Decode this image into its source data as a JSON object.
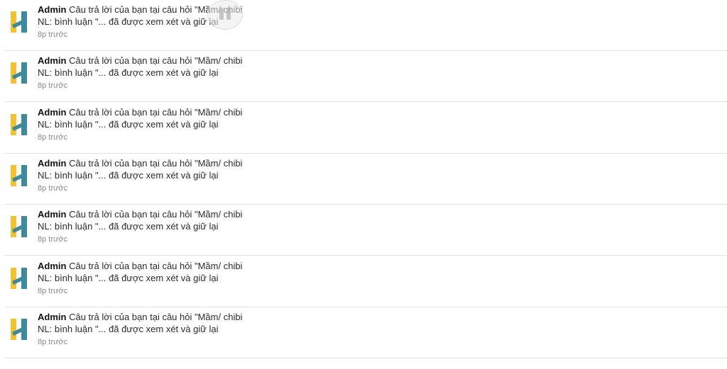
{
  "notifications": [
    {
      "author": "Admin",
      "message": "Câu trả lời của bạn tại câu hỏi \"Mầm/ chibi NL: bình luận \"... đã được xem xét và giữ lại",
      "time": "8p trước"
    },
    {
      "author": "Admin",
      "message": "Câu trả lời của bạn tại câu hỏi \"Mầm/ chibi NL: bình luận \"... đã được xem xét và giữ lại",
      "time": "8p trước"
    },
    {
      "author": "Admin",
      "message": "Câu trả lời của bạn tại câu hỏi \"Mầm/ chibi NL: bình luận \"... đã được xem xét và giữ lại",
      "time": "8p trước"
    },
    {
      "author": "Admin",
      "message": "Câu trả lời của bạn tại câu hỏi \"Mầm/ chibi NL: bình luận \"... đã được xem xét và giữ lại",
      "time": "8p trước"
    },
    {
      "author": "Admin",
      "message": "Câu trả lời của bạn tại câu hỏi \"Mầm/ chibi NL: bình luận \"... đã được xem xét và giữ lại",
      "time": "8p trước"
    },
    {
      "author": "Admin",
      "message": "Câu trả lời của bạn tại câu hỏi \"Mầm/ chibi NL: bình luận \"... đã được xem xét và giữ lại",
      "time": "8p trước"
    },
    {
      "author": "Admin",
      "message": "Câu trả lời của bạn tại câu hỏi \"Mầm/ chibi NL: bình luận \"... đã được xem xét và giữ lại",
      "time": "8p trước"
    }
  ],
  "avatar_icon": "hoc24-logo-icon",
  "overlay_icon": "pause-icon",
  "colors": {
    "logo_yellow": "#f2c230",
    "logo_teal": "#3f8a9a",
    "divider": "#e2e2e2",
    "time_text": "#8a8a8a"
  }
}
